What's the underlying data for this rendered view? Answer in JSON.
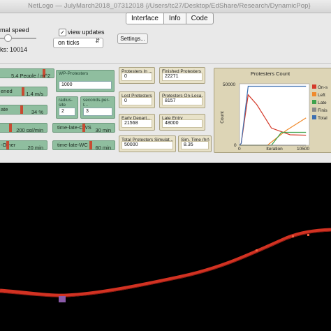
{
  "window": {
    "title": "NetLogo — JulyMarch2018_07312018 {/Users/tc27/Desktop/EdShare/Research/DynamicPop}"
  },
  "tabs": [
    {
      "label": "Interface"
    },
    {
      "label": "Info"
    },
    {
      "label": "Code"
    }
  ],
  "controls": {
    "speed_label": "mal speed",
    "view_updates_label": "view updates",
    "view_updates_checked": true,
    "update_mode": "on ticks",
    "settings_label": "Settings...",
    "ticks_text": "ks: 10014"
  },
  "sliders": [
    {
      "label": "",
      "value": "5.4 People / m^2"
    },
    {
      "label": "ened",
      "value": "1.4 m/s"
    },
    {
      "label": "ate",
      "value": "34 %"
    },
    {
      "label": "",
      "value": "200 ppl/min"
    },
    {
      "label": "-Other",
      "value": "20 min"
    },
    {
      "label": "time-late-CWS",
      "value": "30 min"
    },
    {
      "label": "time-late-WC",
      "value": "60 min"
    }
  ],
  "inputs": [
    {
      "label": "WP-Protesters",
      "value": "1000"
    },
    {
      "label": "radius-site",
      "value": "2"
    },
    {
      "label": "seconds-per-t...",
      "value": "3"
    }
  ],
  "monitors": [
    {
      "label": "Protesters In ...",
      "value": "0"
    },
    {
      "label": "Finished Protesters",
      "value": "22271"
    },
    {
      "label": "Lost Protesters",
      "value": "0"
    },
    {
      "label": "Protesters On-Loca...",
      "value": "8157"
    },
    {
      "label": "Early Depart...",
      "value": "21568"
    },
    {
      "label": "Late Entry",
      "value": "48000"
    },
    {
      "label": "Total Protesters Simulat...",
      "value": "50000"
    },
    {
      "label": "Sim. Time (hr)",
      "value": "8.35"
    }
  ],
  "plot": {
    "chart_data": {
      "type": "line",
      "title": "Protesters Count",
      "xlabel": "Iteration",
      "ylabel": "Count",
      "xlim": [
        0,
        10500
      ],
      "ylim": [
        0,
        50000
      ],
      "tick_labels_y": [
        "50000",
        "0"
      ],
      "tick_labels_x": [
        "0",
        "10500"
      ],
      "legend_position": "right (clipped)",
      "series": [
        {
          "name": "On-s",
          "color": "#d43a2a",
          "x": [
            0,
            250,
            1300,
            2600,
            4800,
            7600,
            10000
          ],
          "y": [
            0,
            1500,
            41000,
            33000,
            14000,
            8500,
            8200
          ]
        },
        {
          "name": "Left",
          "color": "#f08a2c",
          "x": [
            0,
            4200,
            7000,
            10000
          ],
          "y": [
            0,
            0,
            12000,
            22200
          ]
        },
        {
          "name": "Late",
          "color": "#3fa34d",
          "x": [
            0,
            4800,
            6300,
            10000
          ],
          "y": [
            0,
            0,
            10500,
            10500
          ]
        },
        {
          "name": "Finis",
          "color": "#8a8a8a",
          "x": [
            0,
            10000
          ],
          "y": [
            0,
            0
          ]
        },
        {
          "name": "Total",
          "color": "#3d6fb0",
          "x": [
            0,
            250,
            1300,
            10000
          ],
          "y": [
            0,
            1500,
            48000,
            48000
          ]
        }
      ]
    }
  },
  "accent_colors": {
    "slider": "#8fbe9f",
    "monitor": "#e8e2c9",
    "path": "#d23222",
    "agent": "#8a5aa8"
  }
}
